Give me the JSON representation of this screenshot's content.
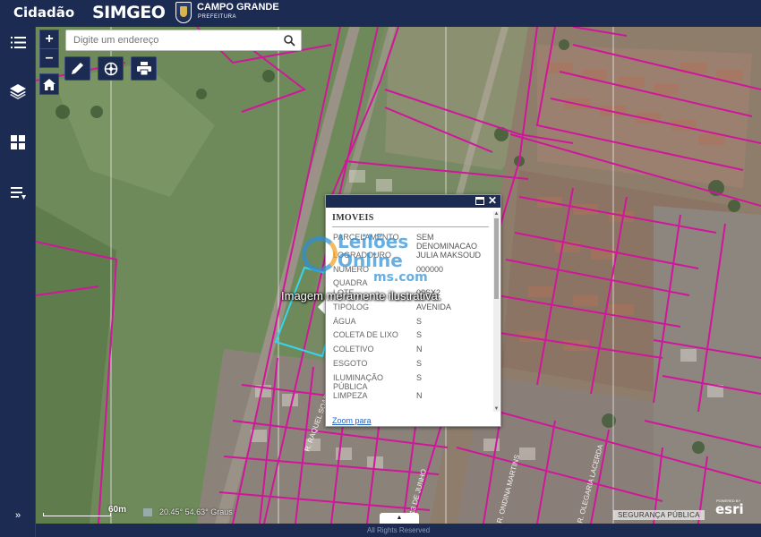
{
  "header": {
    "app_title": "Cidadão",
    "brand": "SIMGEO",
    "city_name": "CAMPO GRANDE",
    "city_subtitle": "PREFEITURA"
  },
  "sidebar": {
    "items": [
      {
        "name": "list-icon"
      },
      {
        "name": "layers-icon"
      },
      {
        "name": "grid-icon"
      },
      {
        "name": "legend-icon"
      }
    ],
    "expand_label": "»"
  },
  "map": {
    "zoom_in": "+",
    "zoom_out": "–",
    "search": {
      "placeholder": "Digite um endereço"
    },
    "tools": [
      "pencil-icon",
      "measure-icon",
      "print-icon"
    ],
    "scale_label": "60m",
    "coords_text": "20.45° 54.63° Graus",
    "bottom_tab": "▲",
    "attribution": "SEGURANÇA PÚBLICA",
    "esri_label": "esri",
    "esri_powered": "POWERED BY",
    "overlay_text": "Imagem meramente ilustrativa.",
    "watermark": {
      "line1": "Leilões",
      "line2": "Online",
      "line3": "ms.com"
    }
  },
  "popup": {
    "title": "IMOVEIS",
    "rows": [
      {
        "key": "PARCELAMENTO",
        "value": "SEM DENOMINACAO"
      },
      {
        "key": "LOGRADOURO",
        "value": "JULIA MAKSOUD"
      },
      {
        "key": "NUMERO",
        "value": "000000"
      },
      {
        "key": "QUADRA",
        "value": ""
      },
      {
        "key": "LOTE",
        "value": "00SX2"
      },
      {
        "key": "TIPOLOG",
        "value": "AVENIDA"
      },
      {
        "key": "ÁGUA",
        "value": "S"
      },
      {
        "key": "COLETA DE LIXO",
        "value": "S"
      },
      {
        "key": "COLETIVO",
        "value": "N"
      },
      {
        "key": "ESGOTO",
        "value": "S"
      },
      {
        "key": "ILUMINAÇÃO PÚBLICA",
        "value": "S"
      },
      {
        "key": "LIMPEZA",
        "value": "N"
      }
    ],
    "zoom_link": "Zoom para"
  },
  "footer": {
    "text": "All Rights Reserved"
  }
}
